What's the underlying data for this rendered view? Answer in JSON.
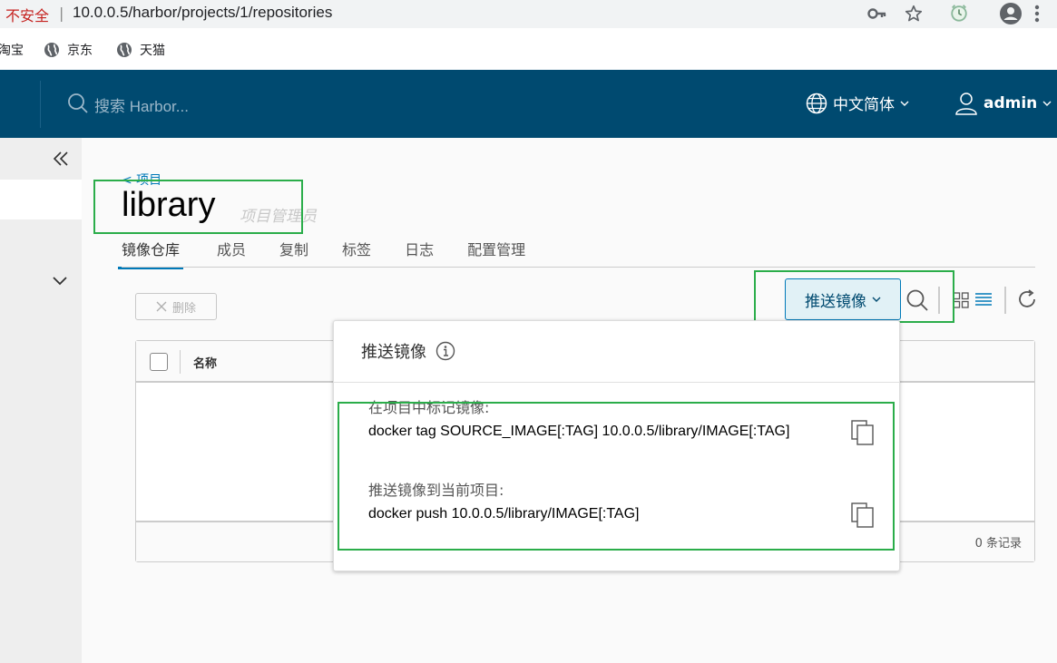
{
  "browser": {
    "insecure_label": "不安全",
    "url": "10.0.0.5/harbor/projects/1/repositories",
    "bookmarks": [
      "淘宝",
      "京东",
      "天猫"
    ]
  },
  "header": {
    "search_placeholder": "搜索 Harbor...",
    "language": "中文简体",
    "user": "admin"
  },
  "project": {
    "back_label": "< 项目",
    "name": "library",
    "role": "项目管理员"
  },
  "tabs": [
    {
      "label": "镜像仓库",
      "active": true
    },
    {
      "label": "成员",
      "active": false
    },
    {
      "label": "复制",
      "active": false
    },
    {
      "label": "标签",
      "active": false
    },
    {
      "label": "日志",
      "active": false
    },
    {
      "label": "配置管理",
      "active": false
    }
  ],
  "toolbar": {
    "delete_label": "删除",
    "push_label": "推送镜像"
  },
  "grid": {
    "column_name": "名称",
    "footer_count": "0 条记录"
  },
  "push_dropdown": {
    "title": "推送镜像",
    "tag_label": "在项目中标记镜像:",
    "tag_command": "docker tag SOURCE_IMAGE[:TAG] 10.0.0.5/library/IMAGE[:TAG]",
    "push_label": "推送镜像到当前项目:",
    "push_command": "docker push 10.0.0.5/library/IMAGE[:TAG]"
  },
  "colors": {
    "header_bg": "#004a70",
    "accent": "#0079b8",
    "highlight_box": "#2bad4a"
  }
}
